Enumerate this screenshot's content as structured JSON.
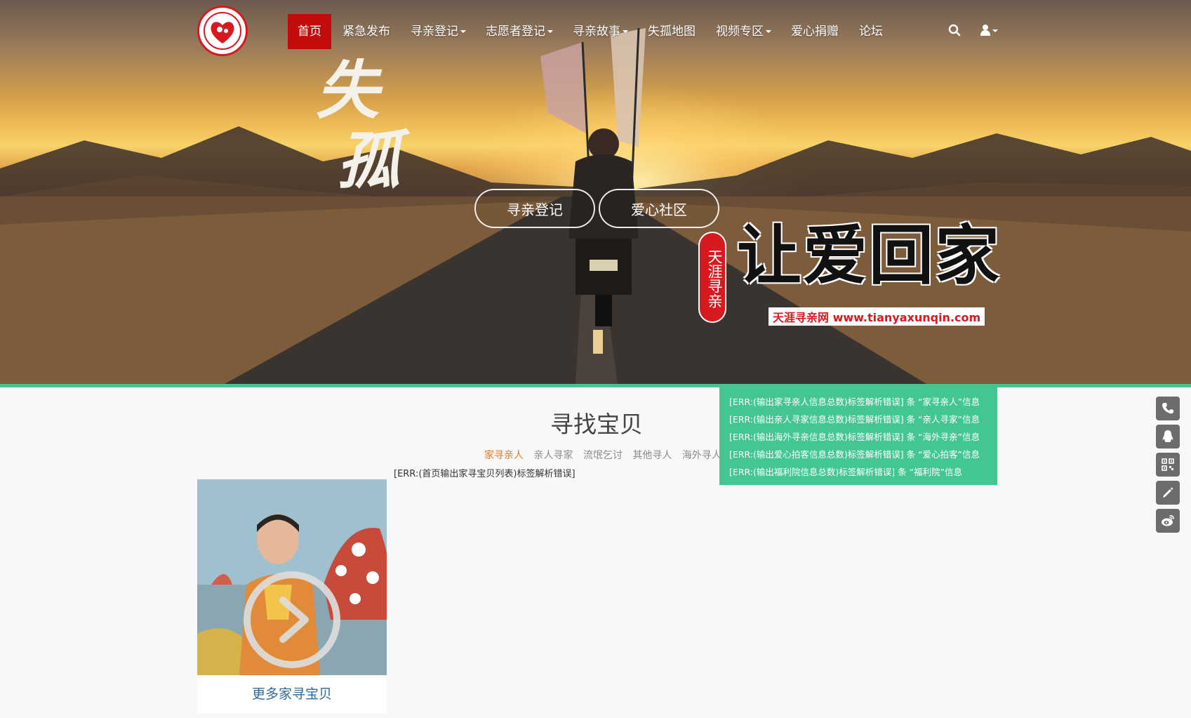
{
  "nav": {
    "items": [
      {
        "label": "首页",
        "active": true,
        "dropdown": false
      },
      {
        "label": "紧急发布",
        "active": false,
        "dropdown": false
      },
      {
        "label": "寻亲登记",
        "active": false,
        "dropdown": true
      },
      {
        "label": "志愿者登记",
        "active": false,
        "dropdown": true
      },
      {
        "label": "寻亲故事",
        "active": false,
        "dropdown": true
      },
      {
        "label": "失孤地图",
        "active": false,
        "dropdown": false
      },
      {
        "label": "视频专区",
        "active": false,
        "dropdown": true
      },
      {
        "label": "爱心捐赠",
        "active": false,
        "dropdown": false
      },
      {
        "label": "论坛",
        "active": false,
        "dropdown": false
      }
    ],
    "icons": [
      "search-icon",
      "user-icon"
    ]
  },
  "hero": {
    "calligraphy": "失孤",
    "buttons": [
      "寻亲登记",
      "爱心社区"
    ],
    "slogan_badge": "天涯寻亲",
    "slogan_main": "让爱回家",
    "slogan_sub": "天涯寻亲网 www.tianyaxunqin.com"
  },
  "main": {
    "title": "寻找宝贝",
    "tabs": [
      "家寻亲人",
      "亲人寻家",
      "流氓乞讨",
      "其他寻人",
      "海外寻人"
    ],
    "error": "[ERR:(首页输出家寻宝贝列表)标签解析错误]",
    "card_label": "更多家寻宝贝"
  },
  "stats": [
    "[ERR:(输出家寻亲人信息总数)标签解析错误] 条 “家寻亲人”信息",
    "[ERR:(输出亲人寻家信息总数)标签解析错误] 条 “亲人寻家”信息",
    "[ERR:(输出海外寻亲信息总数)标签解析错误] 条 “海外寻亲”信息",
    "[ERR:(输出爱心拍客信息总数)标签解析错误] 条 “爱心拍客”信息",
    "[ERR:(输出福利院信息总数)标签解析错误] 条 “福利院”信息"
  ],
  "side_tools": [
    "phone-icon",
    "qq-icon",
    "qrcode-icon",
    "edit-icon",
    "weibo-icon"
  ],
  "colors": {
    "accent_red": "#c20c0c",
    "teal": "#44c693",
    "tab_active": "#e07b22",
    "link_blue": "#2d6a9a"
  }
}
